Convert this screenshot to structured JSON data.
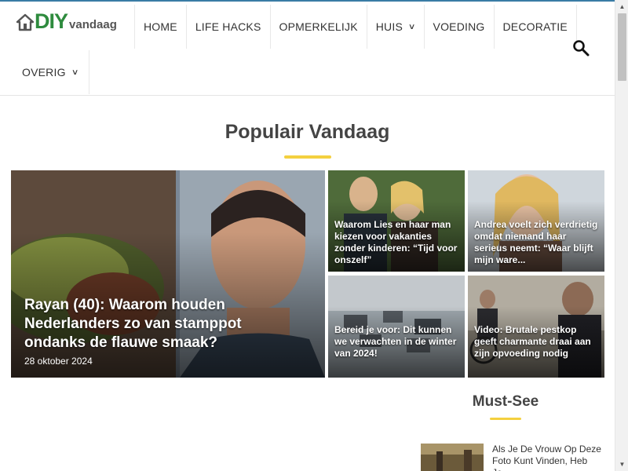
{
  "logo": {
    "main": "DIY",
    "sub": "vandaag"
  },
  "nav": {
    "items": [
      {
        "label": "HOME",
        "dropdown": false
      },
      {
        "label": "LIFE HACKS",
        "dropdown": false
      },
      {
        "label": "OPMERKELIJK",
        "dropdown": false
      },
      {
        "label": "HUIS",
        "dropdown": true
      },
      {
        "label": "VOEDING",
        "dropdown": false
      },
      {
        "label": "DECORATIE",
        "dropdown": false
      },
      {
        "label": "OVERIG",
        "dropdown": true
      }
    ],
    "search_icon": "search-icon"
  },
  "section": {
    "title": "Populair Vandaag"
  },
  "featured": {
    "title": "Rayan (40): Waarom houden Nederlanders zo van stamppot ondanks de flauwe smaak?",
    "date": "28 oktober 2024"
  },
  "articles": [
    {
      "title": "Waarom Lies en haar man kiezen voor vakanties zonder kinderen: “Tijd voor onszelf”"
    },
    {
      "title": "Andrea voelt zich verdrietig omdat niemand haar serieus neemt: “Waar blijft mijn ware..."
    },
    {
      "title": "Bereid je voor: Dit kunnen we verwachten in de winter van 2024!"
    },
    {
      "title": "Video: Brutale pestkop geeft charmante draai aan zijn opvoeding nodig"
    }
  ],
  "must_see": {
    "title": "Must-See",
    "items": [
      {
        "title": "Als Je De Vrouw Op Deze Foto Kunt Vinden, Heb Je..."
      }
    ]
  },
  "colors": {
    "accent": "#f4d03f",
    "logo_green": "#2e8b3e",
    "top_line": "#3a7ca5"
  }
}
